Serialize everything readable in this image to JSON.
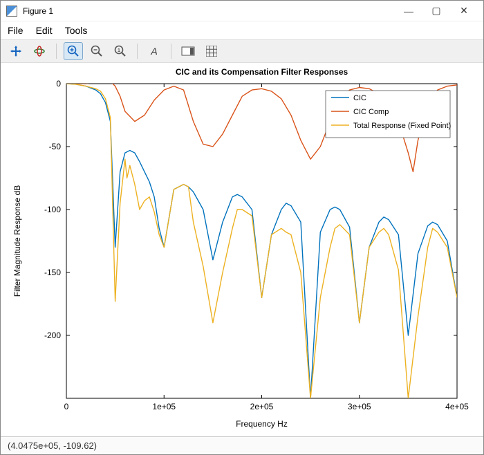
{
  "window": {
    "title": "Figure 1",
    "min_tooltip": "Minimize",
    "max_tooltip": "Maximize",
    "close_tooltip": "Close"
  },
  "menu": {
    "file": "File",
    "edit": "Edit",
    "tools": "Tools"
  },
  "toolbar": {
    "pan": "Pan",
    "rotate": "Rotate 3D",
    "zoom_in": "Zoom In",
    "zoom_out": "Zoom Out",
    "zoom_reset": "Restore View",
    "text": "Insert Text",
    "colorbar": "Insert Colorbar",
    "grid": "Grid"
  },
  "status": {
    "coords": "(4.0475e+05, -109.62)"
  },
  "chart_data": {
    "type": "line",
    "title": "CIC and its Compensation Filter Responses",
    "xlabel": "Frequency Hz",
    "ylabel": "Filter Magnitude Response dB",
    "xlim": [
      0,
      400000
    ],
    "ylim": [
      -250,
      0
    ],
    "xticks": [
      0,
      100000,
      200000,
      300000,
      400000
    ],
    "xticklabels": [
      "0",
      "1e+05",
      "2e+05",
      "3e+05",
      "4e+05"
    ],
    "yticks": [
      -200,
      -150,
      -100,
      -50,
      0
    ],
    "colors": {
      "CIC": "#0072BD",
      "CIC Comp": "#D95319",
      "Total Response (Fixed Point)": "#EDB120"
    },
    "legend": [
      "CIC",
      "CIC Comp",
      "Total Response (Fixed Point)"
    ],
    "series": [
      {
        "name": "CIC",
        "x": [
          0,
          10000,
          20000,
          30000,
          35000,
          40000,
          45000,
          50000,
          55000,
          60000,
          65000,
          70000,
          75000,
          80000,
          85000,
          90000,
          95000,
          100000,
          110000,
          120000,
          125000,
          130000,
          140000,
          150000,
          160000,
          170000,
          175000,
          180000,
          190000,
          200000,
          210000,
          220000,
          225000,
          230000,
          240000,
          250000,
          260000,
          270000,
          275000,
          280000,
          290000,
          300000,
          310000,
          320000,
          325000,
          330000,
          340000,
          350000,
          360000,
          370000,
          375000,
          380000,
          390000,
          400000
        ],
        "y": [
          0,
          -0.5,
          -2,
          -5,
          -8,
          -15,
          -30,
          -130,
          -70,
          -55,
          -53,
          -55,
          -62,
          -70,
          -78,
          -90,
          -115,
          -130,
          -84,
          -80,
          -82,
          -86,
          -100,
          -140,
          -110,
          -90,
          -88,
          -90,
          -100,
          -170,
          -120,
          -100,
          -95,
          -97,
          -110,
          -250,
          -118,
          -100,
          -98,
          -100,
          -114,
          -190,
          -130,
          -110,
          -106,
          -108,
          -120,
          -200,
          -135,
          -113,
          -110,
          -112,
          -125,
          -170
        ]
      },
      {
        "name": "CIC Comp",
        "x": [
          0,
          20000,
          30000,
          40000,
          45000,
          50000,
          55000,
          60000,
          70000,
          80000,
          90000,
          100000,
          110000,
          120000,
          130000,
          140000,
          150000,
          160000,
          170000,
          180000,
          190000,
          200000,
          210000,
          220000,
          230000,
          240000,
          250000,
          260000,
          270000,
          280000,
          290000,
          300000,
          310000,
          320000,
          330000,
          340000,
          350000,
          355000,
          360000,
          370000,
          380000,
          390000,
          400000
        ],
        "y": [
          0,
          0,
          1,
          2,
          2,
          -2,
          -10,
          -22,
          -30,
          -25,
          -13,
          -5,
          -2,
          -5,
          -30,
          -48,
          -50,
          -40,
          -25,
          -10,
          -5,
          -4,
          -6,
          -12,
          -25,
          -45,
          -60,
          -50,
          -30,
          -12,
          -5,
          -3,
          -4,
          -8,
          -15,
          -30,
          -55,
          -70,
          -45,
          -18,
          -5,
          -2,
          -1
        ]
      },
      {
        "name": "Total Response (Fixed Point)",
        "x": [
          0,
          10000,
          20000,
          30000,
          35000,
          40000,
          45000,
          50000,
          55000,
          60000,
          62000,
          65000,
          70000,
          75000,
          80000,
          85000,
          90000,
          95000,
          100000,
          110000,
          120000,
          125000,
          130000,
          140000,
          150000,
          160000,
          170000,
          175000,
          180000,
          190000,
          200000,
          210000,
          220000,
          225000,
          230000,
          240000,
          250000,
          260000,
          270000,
          275000,
          280000,
          290000,
          300000,
          310000,
          320000,
          325000,
          330000,
          340000,
          350000,
          360000,
          370000,
          375000,
          380000,
          390000,
          400000
        ],
        "y": [
          0,
          -0.5,
          -2,
          -4,
          -6,
          -12,
          -27,
          -173,
          -95,
          -60,
          -75,
          -65,
          -80,
          -100,
          -93,
          -90,
          -102,
          -120,
          -130,
          -84,
          -80,
          -82,
          -110,
          -145,
          -190,
          -150,
          -115,
          -100,
          -100,
          -105,
          -170,
          -120,
          -115,
          -118,
          -120,
          -150,
          -250,
          -170,
          -130,
          -115,
          -112,
          -120,
          -190,
          -130,
          -118,
          -115,
          -120,
          -148,
          -250,
          -185,
          -130,
          -115,
          -118,
          -130,
          -170
        ]
      }
    ]
  }
}
